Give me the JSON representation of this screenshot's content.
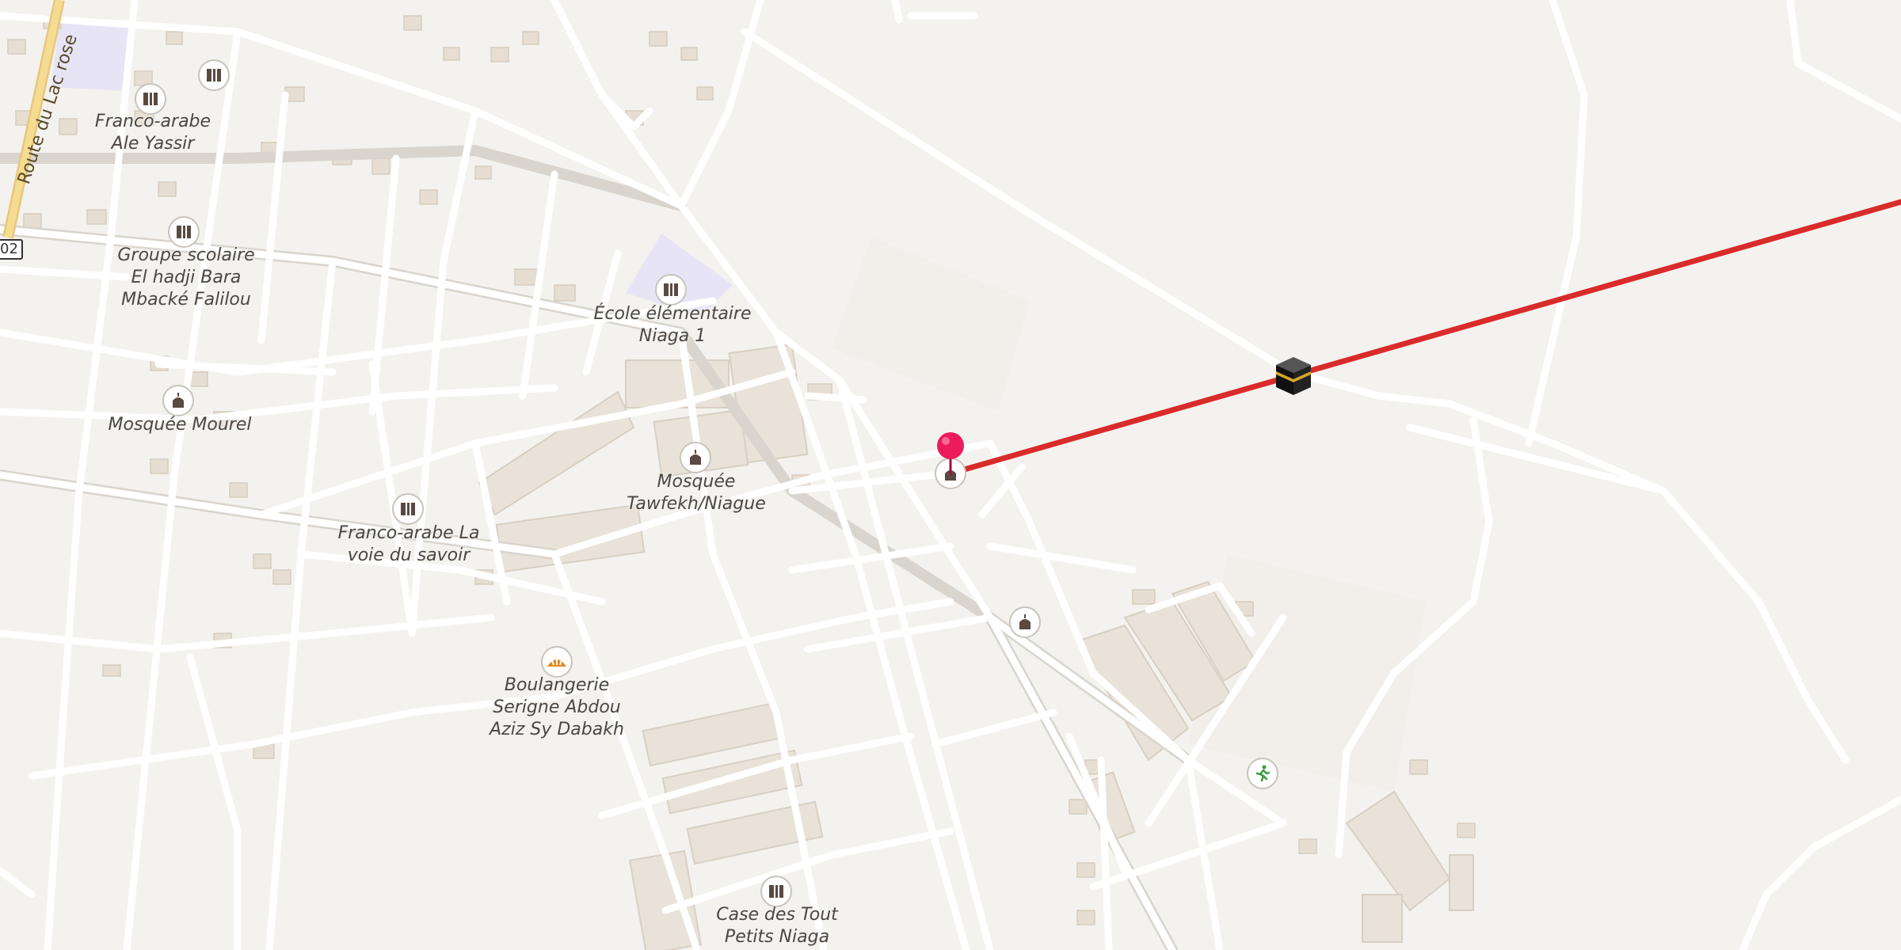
{
  "map": {
    "road_name": "Route du Lac rose",
    "road_ref": "02",
    "route_line_color": "#d92b2b",
    "pin_color": "#ec1c5c",
    "labels": [
      {
        "lines": [
          "Franco-arabe",
          "Ale Yassir"
        ]
      },
      {
        "lines": [
          "Groupe scolaire",
          "El hadji Bara",
          "Mbacké Falilou"
        ]
      },
      {
        "lines": [
          "École élémentaire",
          "Niaga 1"
        ]
      },
      {
        "lines": [
          "Mosquée Mourel"
        ]
      },
      {
        "lines": [
          "Mosquée",
          "Tawfekh/Niague"
        ]
      },
      {
        "lines": [
          "Franco-arabe La",
          "voie du savoir"
        ]
      },
      {
        "lines": [
          "Boulangerie",
          "Serigne Abdou",
          "Aziz Sy Dabakh"
        ]
      },
      {
        "lines": [
          "Case des Tout",
          "Petits Niaga"
        ]
      }
    ],
    "icons": {
      "school": "school-icon",
      "mosque": "mosque-icon",
      "bakery": "bakery-icon",
      "sports": "running-icon",
      "kaaba": "kaaba-icon",
      "pin": "location-pin-icon"
    }
  }
}
